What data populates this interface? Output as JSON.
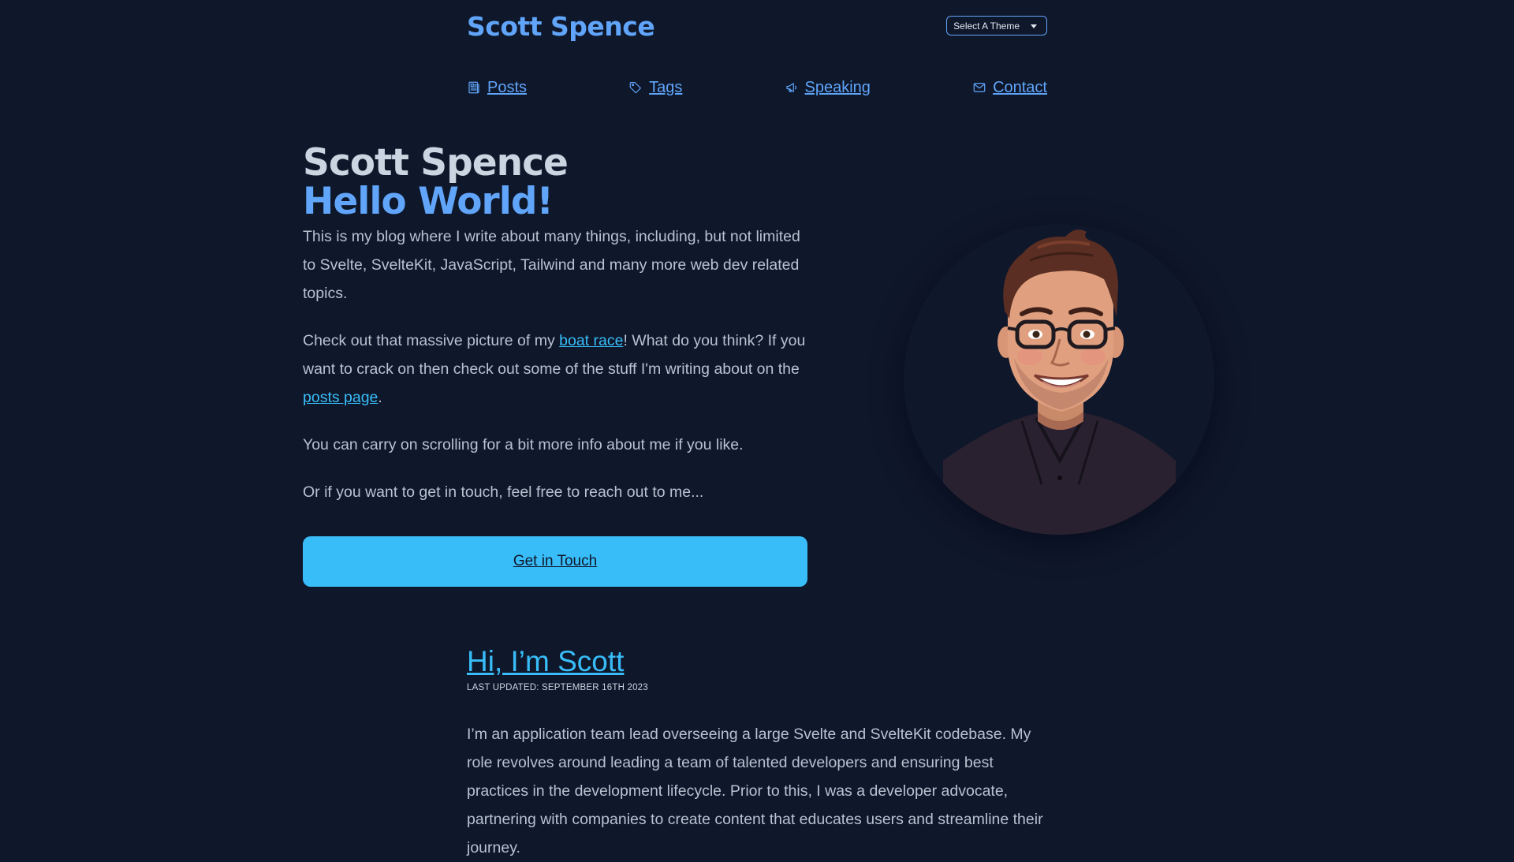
{
  "header": {
    "site_title": "Scott Spence",
    "theme_select_label": "Select A Theme"
  },
  "nav": {
    "items": [
      {
        "label": "Posts",
        "icon": "newspaper-icon"
      },
      {
        "label": "Tags",
        "icon": "tag-icon"
      },
      {
        "label": "Speaking",
        "icon": "megaphone-icon"
      },
      {
        "label": "Contact",
        "icon": "mail-icon"
      }
    ]
  },
  "hero": {
    "name": "Scott Spence",
    "greeting": "Hello World!",
    "para1": "This is my blog where I write about many things, including, but not limited to Svelte, SvelteKit, JavaScript, Tailwind and many more web dev related topics.",
    "para2_before": "Check out that massive picture of my ",
    "para2_link1": "boat race",
    "para2_middle": "! What do you think? If you want to crack on then check out some of the stuff I'm writing about on the ",
    "para2_link2": "posts page",
    "para2_after": ".",
    "para3": "You can carry on scrolling for a bit more info about me if you like.",
    "para4": "Or if you want to get in touch, feel free to reach out to me...",
    "cta_label": "Get in Touch"
  },
  "about": {
    "title": "Hi, I’m Scott",
    "last_updated": "LAST UPDATED: SEPTEMBER 16TH 2023",
    "text": "I’m an application team lead overseeing a large Svelte and SvelteKit codebase. My role revolves around leading a team of talented developers and ensuring best practices in the development lifecycle. Prior to this, I was a developer advocate, partnering with companies to create content that educates users and streamline their journey."
  },
  "colors": {
    "background": "#0f172a",
    "accent": "#60a5fa",
    "link": "#38bdf8",
    "text": "#cbd5e1"
  }
}
